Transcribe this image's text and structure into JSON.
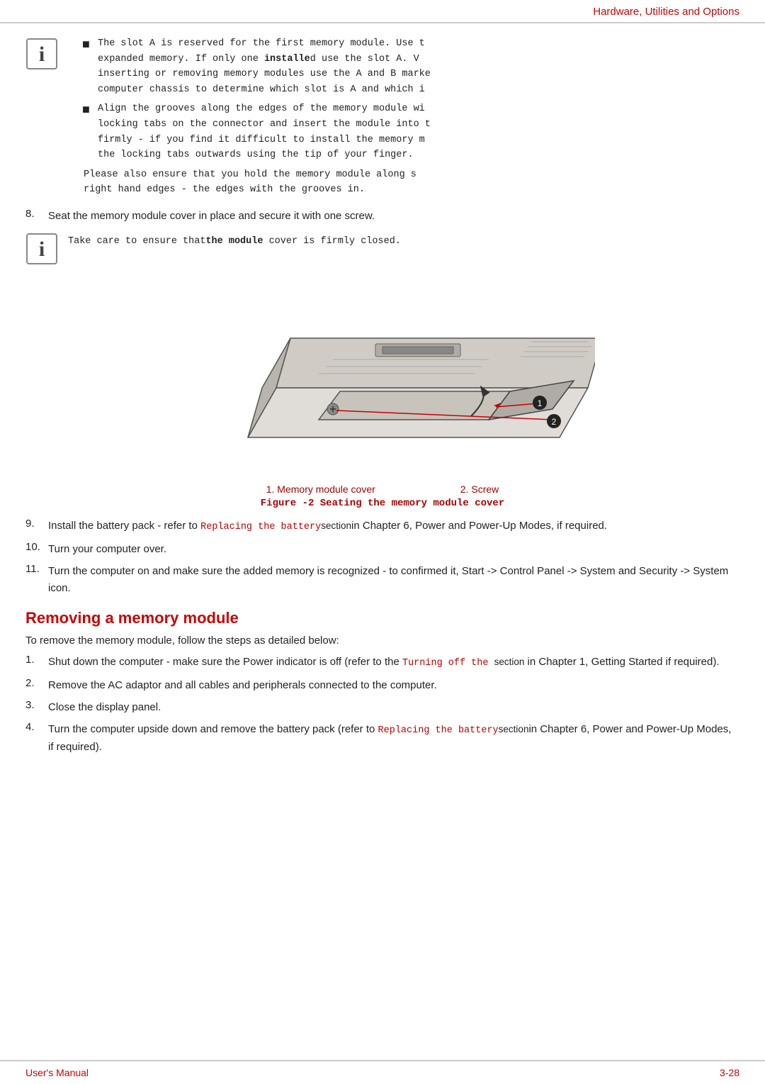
{
  "header": {
    "title": "Hardware, Utilities and Options"
  },
  "info_blocks": [
    {
      "id": "info1",
      "bullets": [
        "The slot A is reserved for the first memory module. Use t expanded memory. If only one ​​​​installed use the slot A. V inserting or removing memory modules use the A and B marke computer chassis to determine which slot is A and which i",
        "Align the grooves along the edges of the memory module wi locking tabs on the connector and insert the module into ​firmly - if you find it difficult to install the memory m the locking tabs outwards using the tip of your finger."
      ],
      "extra": "Please also ensure that you hold the memory module along ​right hand edges - the edges with the grooves in."
    }
  ],
  "step8": "Seat the memory module cover in place and secure it with one screw.",
  "info2_text": "Take care to ensure that​​​​the​​​​ module cover is firmly closed.",
  "figure": {
    "label1": "1. Memory module cover",
    "label2": "2. Screw",
    "caption": "Figure -2 Seating the memory module cover"
  },
  "steps_9_to_11": [
    {
      "num": "9.",
      "text_before": "Install the battery pack - refer to ",
      "link": "Replacing the battery",
      "text_link_suffix": "section",
      "text_after": "in Chapter 6, Power and Power-Up Modes, if required."
    },
    {
      "num": "10.",
      "text": "Turn your computer over."
    },
    {
      "num": "11.",
      "text": "Turn the computer on and make sure the added memory is recognized - to confirmed it, Start -> Control Panel  -> System and Security  -> System  icon."
    }
  ],
  "section_heading": "Removing a memory module",
  "section_intro": "To remove the memory module, follow the steps as detailed below:",
  "remove_steps": [
    {
      "num": "1.",
      "text_before": "Shut down the computer - make sure the Power  indicator is off (refer to the ",
      "link": "Turning off the ",
      "link_suffix": "section",
      "text_after": " in Chapter 1, Getting Started if required)."
    },
    {
      "num": "2.",
      "text": "Remove the AC adaptor and all cables and peripherals connected to the computer."
    },
    {
      "num": "3.",
      "text": "Close the display panel."
    },
    {
      "num": "4.",
      "text_before": "Turn the computer upside down and remove the battery pack (refer to ",
      "link": "Replacing the battery",
      "link_suffix": "section",
      "text_after": "in Chapter 6, Power and Power-Up Modes, if required)."
    }
  ],
  "footer": {
    "left": "User's Manual",
    "right": "3-28"
  }
}
